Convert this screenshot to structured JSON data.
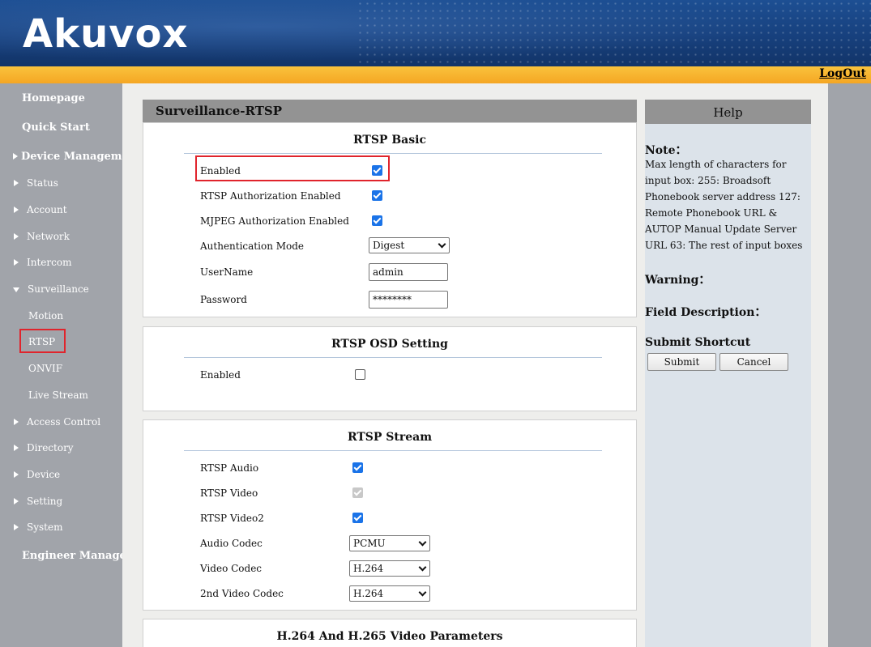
{
  "header": {
    "logo": "Akuvox",
    "logout": "LogOut"
  },
  "sidebar": {
    "homepage": "Homepage",
    "quick_start": "Quick Start",
    "device_management": "Device Management",
    "status": "Status",
    "account": "Account",
    "network": "Network",
    "intercom": "Intercom",
    "surveillance": "Surveillance",
    "motion": "Motion",
    "rtsp": "RTSP",
    "onvif": "ONVIF",
    "live_stream": "Live Stream",
    "access_control": "Access Control",
    "directory": "Directory",
    "device": "Device",
    "setting": "Setting",
    "system": "System",
    "engineer": "Engineer Manage…"
  },
  "panel": {
    "title": "Surveillance-RTSP"
  },
  "rtsp_basic": {
    "title": "RTSP Basic",
    "enabled_label": "Enabled",
    "auth_label": "RTSP Authorization Enabled",
    "mjpeg_label": "MJPEG Authorization Enabled",
    "auth_mode_label": "Authentication Mode",
    "auth_mode_value": "Digest",
    "username_label": "UserName",
    "username_value": "admin",
    "password_label": "Password",
    "password_value": "********"
  },
  "osd": {
    "title": "RTSP OSD Setting",
    "enabled_label": "Enabled"
  },
  "stream": {
    "title": "RTSP Stream",
    "audio_label": "RTSP Audio",
    "video_label": "RTSP Video",
    "video2_label": "RTSP Video2",
    "audio_codec_label": "Audio Codec",
    "audio_codec_value": "PCMU",
    "video_codec_label": "Video Codec",
    "video_codec_value": "H.264",
    "video2_codec_label": "2nd Video Codec",
    "video2_codec_value": "H.264"
  },
  "video_params": {
    "title": "H.264 And H.265 Video Parameters"
  },
  "help": {
    "title": "Help",
    "note_heading": "Note：",
    "note_text": "Max length of characters for input box: 255: Broadsoft Phonebook server address 127: Remote Phonebook URL & AUTOP Manual Update Server URL 63: The rest of input boxes",
    "warning_heading": "Warning：",
    "field_heading": "Field Description：",
    "shortcut_heading": "Submit Shortcut",
    "submit_label": "Submit",
    "cancel_label": "Cancel"
  }
}
